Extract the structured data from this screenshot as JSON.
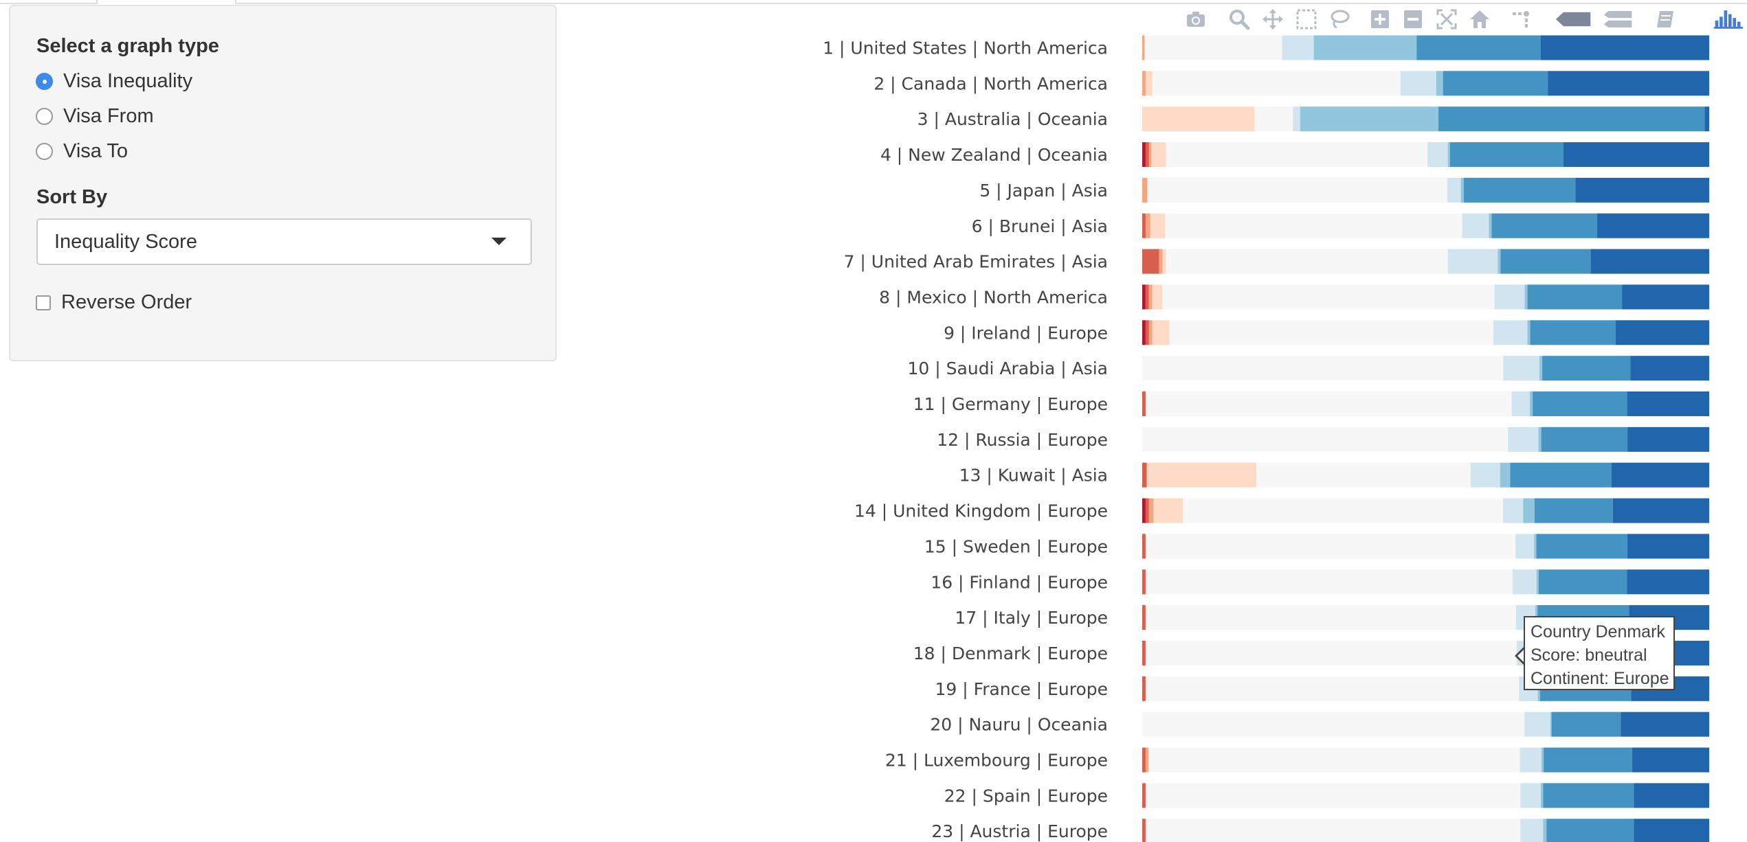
{
  "sidebar": {
    "graph_type_label": "Select a graph type",
    "graph_options": [
      {
        "label": "Visa Inequality",
        "checked": true
      },
      {
        "label": "Visa From",
        "checked": false
      },
      {
        "label": "Visa To",
        "checked": false
      }
    ],
    "sort_label": "Sort By",
    "sort_value": "Inequality Score",
    "reverse_label": "Reverse Order",
    "reverse_checked": false
  },
  "modebar": {
    "icons": [
      "camera-icon",
      "zoom-icon",
      "pan-icon",
      "box-select-icon",
      "lasso-select-icon",
      "zoom-in-icon",
      "zoom-out-icon",
      "autoscale-icon",
      "reset-axes-icon",
      "spike-lines-icon",
      "hover-closest-icon",
      "hover-compare-icon",
      "edit-chart-icon",
      "plotly-logo-icon"
    ]
  },
  "tooltip": {
    "country": "Country Denmark",
    "score": "Score: bneutral",
    "continent": "Continent: Europe"
  },
  "chart_data": {
    "type": "bar",
    "orientation": "horizontal",
    "stacked": true,
    "scale_note": "each row sums to 100% of visa relationships",
    "category_colors": {
      "r1": "#b2182b",
      "r2": "#d6604d",
      "r3": "#f4a582",
      "r4": "#fddbc7",
      "neutral": "#f7f7f7",
      "b4": "#d1e5f0",
      "b3": "#92c5de",
      "b2": "#4393c3",
      "b1": "#2166ac"
    },
    "categories": [
      "r1",
      "r2",
      "r3",
      "r4",
      "neutral",
      "b4",
      "b3",
      "b2",
      "b1"
    ],
    "rows": [
      {
        "rank": 1,
        "country": "United States",
        "continent": "North America",
        "values": [
          0,
          0,
          0.4,
          0,
          23.4,
          5.4,
          17.5,
          21.1,
          28.7
        ]
      },
      {
        "rank": 2,
        "country": "Canada",
        "continent": "North America",
        "values": [
          0,
          0,
          0.6,
          1.2,
          43.8,
          6.3,
          1.2,
          18.5,
          28.5
        ]
      },
      {
        "rank": 3,
        "country": "Australia",
        "continent": "Oceania",
        "values": [
          0,
          0,
          0,
          19.8,
          6.8,
          1.3,
          24.4,
          47.0,
          0.8
        ]
      },
      {
        "rank": 4,
        "country": "New Zealand",
        "continent": "Oceania",
        "values": [
          0.6,
          0.6,
          0.4,
          2.6,
          46.1,
          3.6,
          0.4,
          20.0,
          25.7
        ]
      },
      {
        "rank": 5,
        "country": "Japan",
        "continent": "Asia",
        "values": [
          0,
          0,
          0.9,
          0,
          52.9,
          2.4,
          0.5,
          19.7,
          23.6
        ]
      },
      {
        "rank": 6,
        "country": "Brunei",
        "continent": "Asia",
        "values": [
          0,
          0.6,
          0.8,
          2.6,
          52.5,
          4.7,
          0.5,
          18.6,
          19.8
        ]
      },
      {
        "rank": 7,
        "country": "United Arab Emirates",
        "continent": "Asia",
        "values": [
          0,
          3.0,
          0.6,
          0.6,
          49.7,
          8.8,
          0.5,
          15.9,
          20.9
        ]
      },
      {
        "rank": 8,
        "country": "Mexico",
        "continent": "North America",
        "values": [
          0.6,
          0.6,
          0.6,
          1.8,
          59.4,
          5.4,
          0.5,
          16.9,
          15.6
        ]
      },
      {
        "rank": 9,
        "country": "Ireland",
        "continent": "Europe",
        "values": [
          0.6,
          0.6,
          0.6,
          3.0,
          57.2,
          6.0,
          0.5,
          15.1,
          16.5
        ]
      },
      {
        "rank": 10,
        "country": "Saudi Arabia",
        "continent": "Asia",
        "values": [
          0,
          0,
          0,
          0,
          63.8,
          6.4,
          0.5,
          15.6,
          13.9
        ]
      },
      {
        "rank": 11,
        "country": "Germany",
        "continent": "Europe",
        "values": [
          0,
          0.6,
          0,
          0,
          64.7,
          3.2,
          0.5,
          16.7,
          14.5
        ]
      },
      {
        "rank": 12,
        "country": "Russia",
        "continent": "Europe",
        "values": [
          0,
          0,
          0,
          0,
          64.9,
          5.4,
          0.5,
          15.3,
          14.5
        ]
      },
      {
        "rank": 13,
        "country": "Kuwait",
        "continent": "Asia",
        "values": [
          0,
          0.8,
          0,
          19.4,
          37.9,
          5.2,
          1.8,
          17.9,
          17.3
        ]
      },
      {
        "rank": 14,
        "country": "United Kingdom",
        "continent": "Europe",
        "values": [
          0.6,
          0.6,
          0.8,
          5.2,
          56.8,
          3.6,
          2.0,
          13.9,
          17.1
        ]
      },
      {
        "rank": 15,
        "country": "Sweden",
        "continent": "Europe",
        "values": [
          0,
          0.6,
          0,
          0,
          65.5,
          3.3,
          0.4,
          16.1,
          14.5
        ]
      },
      {
        "rank": 16,
        "country": "Finland",
        "continent": "Europe",
        "values": [
          0,
          0.6,
          0,
          0,
          64.8,
          4.2,
          0.4,
          15.6,
          14.5
        ]
      },
      {
        "rank": 17,
        "country": "Italy",
        "continent": "Europe",
        "values": [
          0,
          0.6,
          0,
          0,
          65.6,
          3.4,
          0.4,
          16.2,
          14.2
        ]
      },
      {
        "rank": 18,
        "country": "Denmark",
        "continent": "Europe",
        "values": [
          0,
          0.6,
          0,
          0,
          65.7,
          3.2,
          0.4,
          16.2,
          14.3
        ]
      },
      {
        "rank": 19,
        "country": "France",
        "continent": "Europe",
        "values": [
          0,
          0.6,
          0,
          0,
          66.0,
          3.3,
          0.4,
          16.1,
          13.8
        ]
      },
      {
        "rank": 20,
        "country": "Nauru",
        "continent": "Oceania",
        "values": [
          0,
          0,
          0,
          0,
          67.4,
          4.6,
          0.2,
          12.2,
          15.6
        ]
      },
      {
        "rank": 21,
        "country": "Luxembourg",
        "continent": "Europe",
        "values": [
          0,
          0.6,
          0.5,
          0,
          65.5,
          3.8,
          0.4,
          15.6,
          13.6
        ]
      },
      {
        "rank": 22,
        "country": "Spain",
        "continent": "Europe",
        "values": [
          0,
          0.6,
          0,
          0,
          66.1,
          3.6,
          0.4,
          16.0,
          13.3
        ]
      },
      {
        "rank": 23,
        "country": "Austria",
        "continent": "Europe",
        "values": [
          0,
          0.6,
          0,
          0,
          66.1,
          4.0,
          0.6,
          15.4,
          13.3
        ]
      }
    ]
  }
}
